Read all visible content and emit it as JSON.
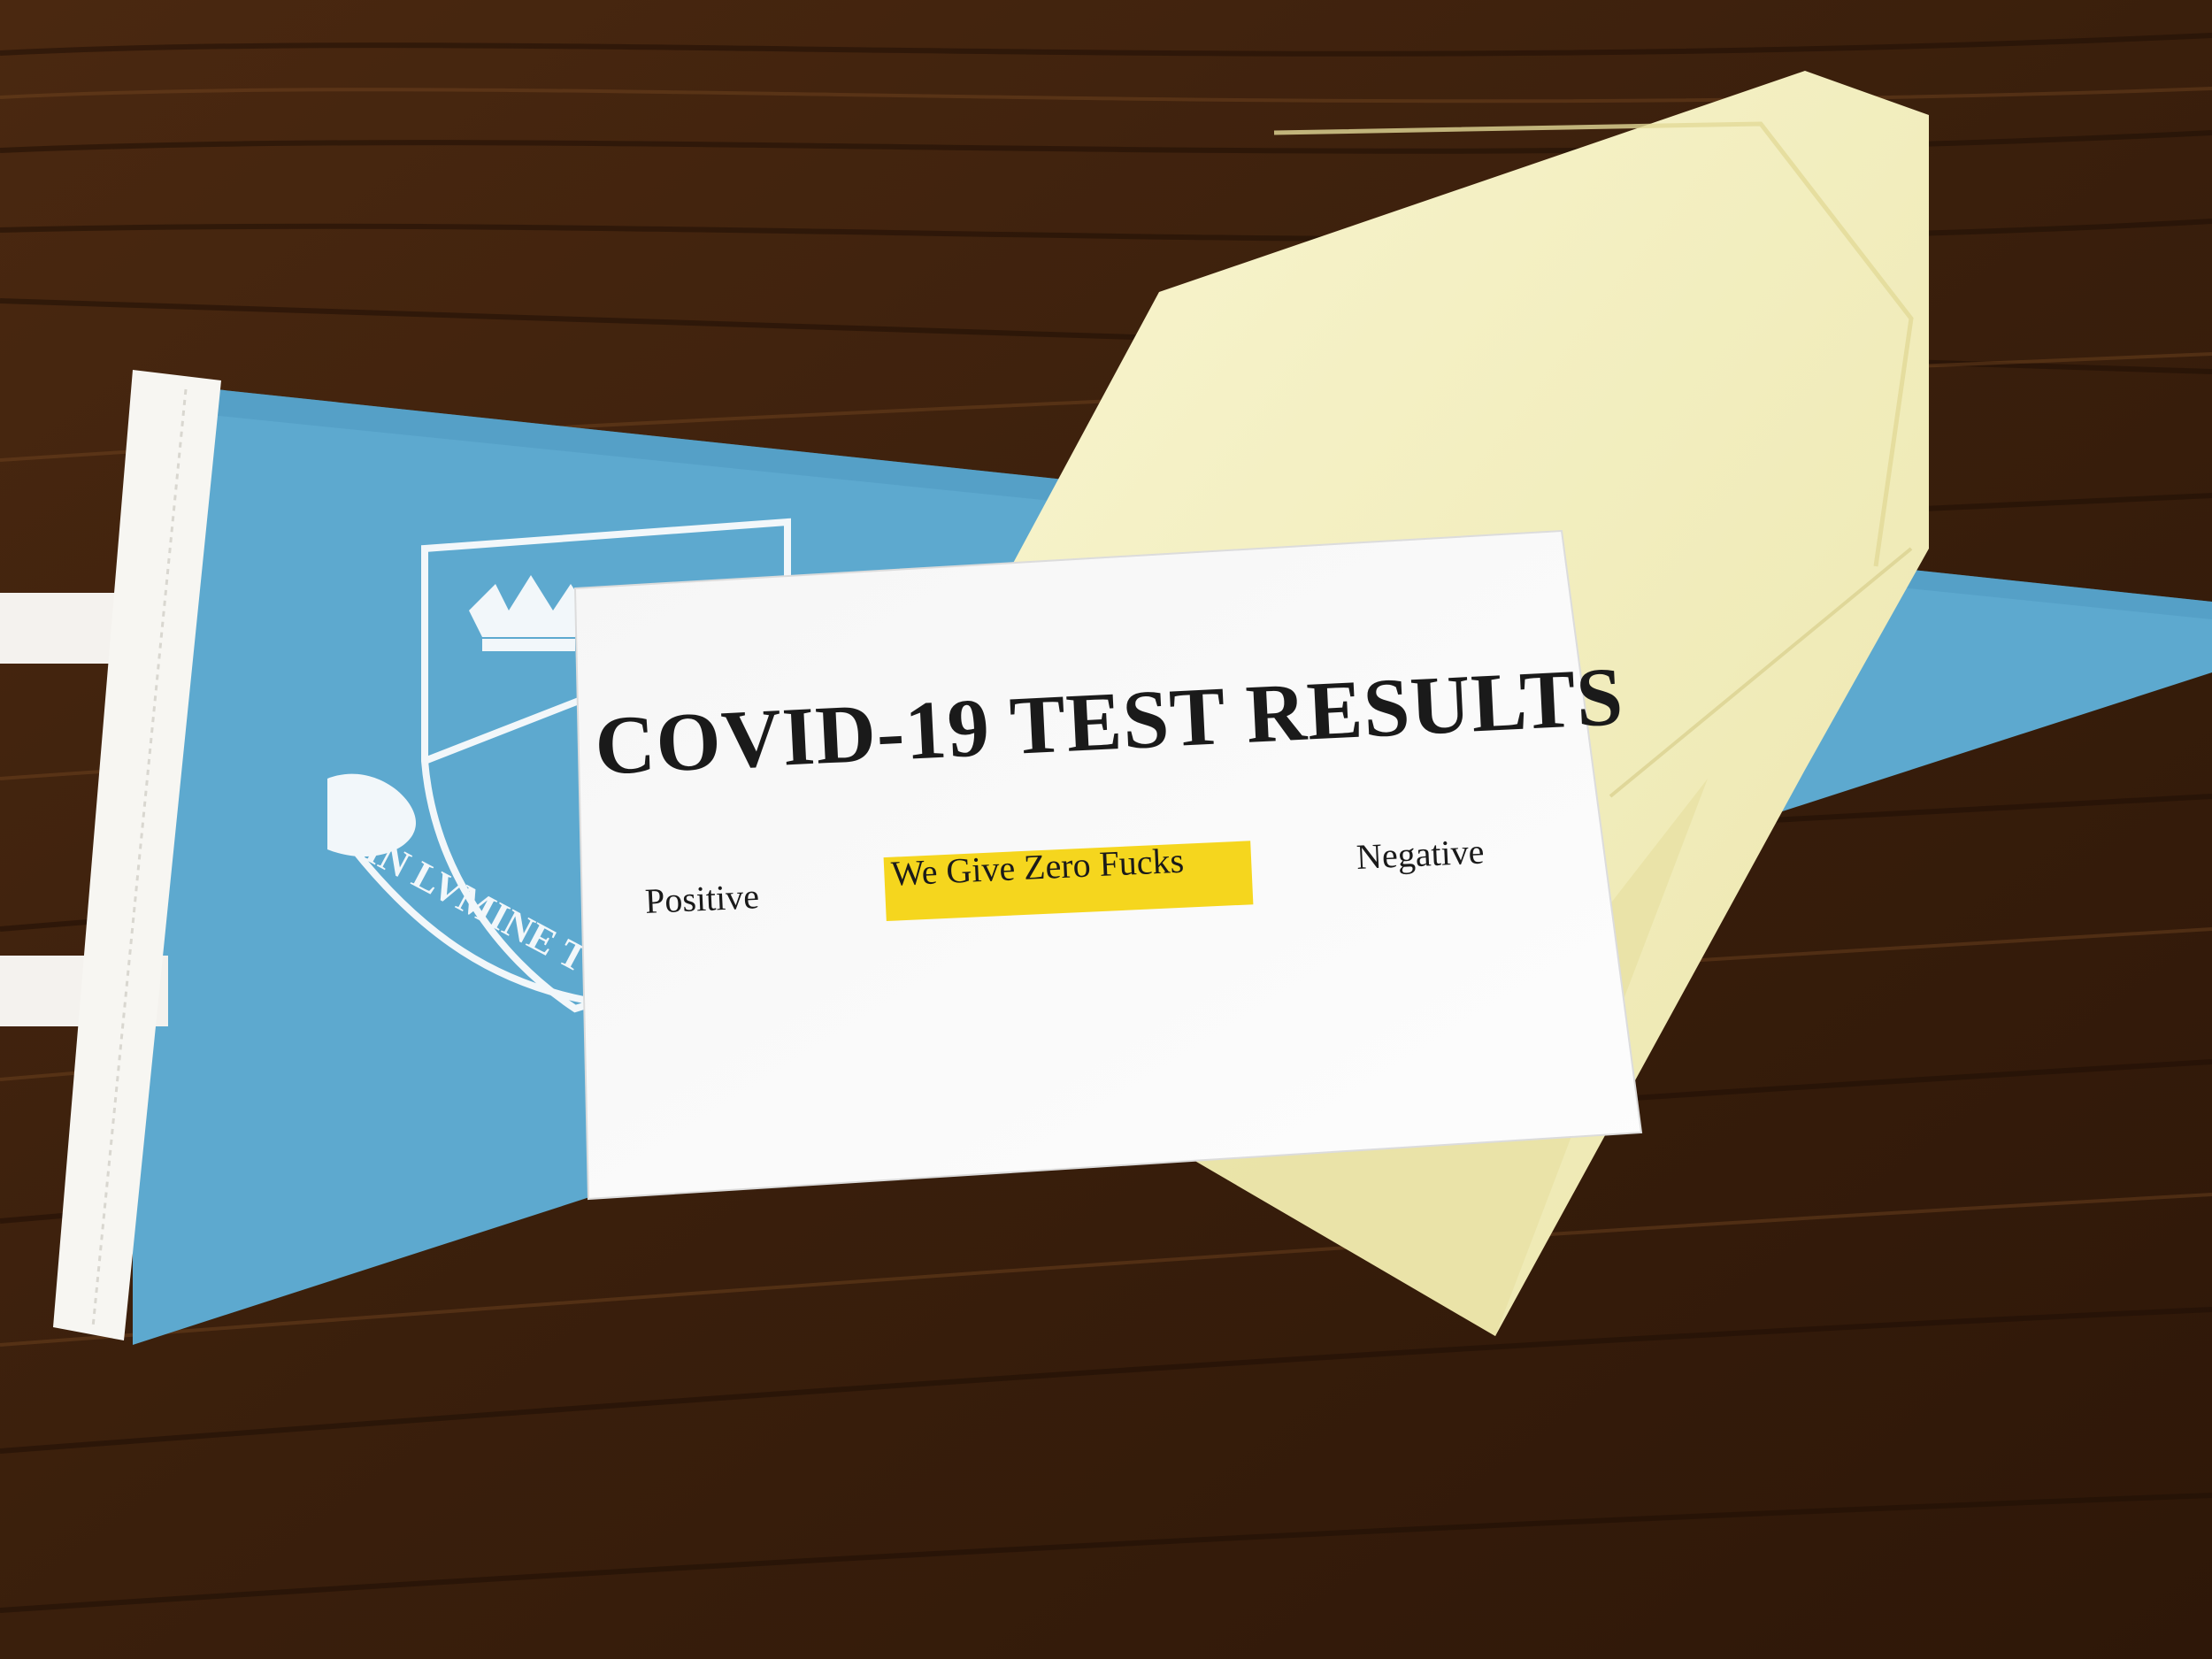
{
  "card": {
    "title": "COVID-19 TEST RESULTS",
    "options": {
      "positive": "Positive",
      "middle": "We Give Zero Fucks",
      "negative": "Negative"
    },
    "highlight_color": "#f5d61e"
  },
  "pennant": {
    "motto": "IN LVMINE TVO",
    "color": "#5da9cf"
  },
  "colors": {
    "wood_dark": "#2b1608",
    "wood_mid": "#5a3216",
    "envelope": "#f6f2c4",
    "paper": "#fbfbfb"
  }
}
